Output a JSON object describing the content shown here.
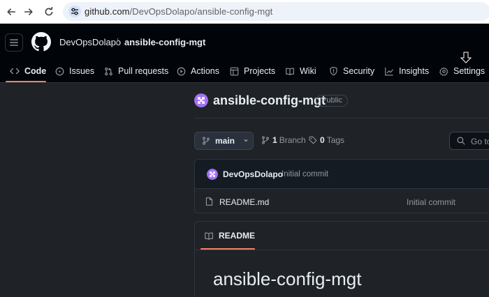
{
  "browser": {
    "url_host": "github.com",
    "url_path": "/DevOpsDolapo/ansible-config-mgt",
    "icons": [
      "back-icon",
      "forward-icon",
      "reload-icon",
      "site-settings-icon"
    ]
  },
  "header": {
    "owner": "DevOpsDolapo",
    "separator": "/",
    "repo": "ansible-config-mgt"
  },
  "tabs": [
    {
      "label": "Code",
      "icon": "code-icon",
      "active": true
    },
    {
      "label": "Issues",
      "icon": "issue-icon"
    },
    {
      "label": "Pull requests",
      "icon": "pull-request-icon"
    },
    {
      "label": "Actions",
      "icon": "play-icon"
    },
    {
      "label": "Projects",
      "icon": "table-icon"
    },
    {
      "label": "Wiki",
      "icon": "book-icon"
    },
    {
      "label": "Security",
      "icon": "shield-icon"
    },
    {
      "label": "Insights",
      "icon": "graph-icon"
    },
    {
      "label": "Settings",
      "icon": "gear-icon"
    }
  ],
  "repo": {
    "title": "ansible-config-mgt",
    "visibility": "Public"
  },
  "branch_bar": {
    "branch": "main",
    "branch_count": "1",
    "branch_label": "Branch",
    "tag_count": "0",
    "tag_label": "Tags",
    "goto_placeholder": "Go to file"
  },
  "latest_commit": {
    "author": "DevOpsDolapo",
    "message": "Initial commit"
  },
  "files": [
    {
      "name": "README.md",
      "commit": "Initial commit"
    }
  ],
  "readme": {
    "tab_label": "README",
    "heading": "ansible-config-mgt"
  },
  "colors": {
    "accent": "#f78166",
    "page_bg": "#1f2328",
    "header_bg": "#010409",
    "border": "#30363d",
    "avatar": "#a371f7"
  }
}
